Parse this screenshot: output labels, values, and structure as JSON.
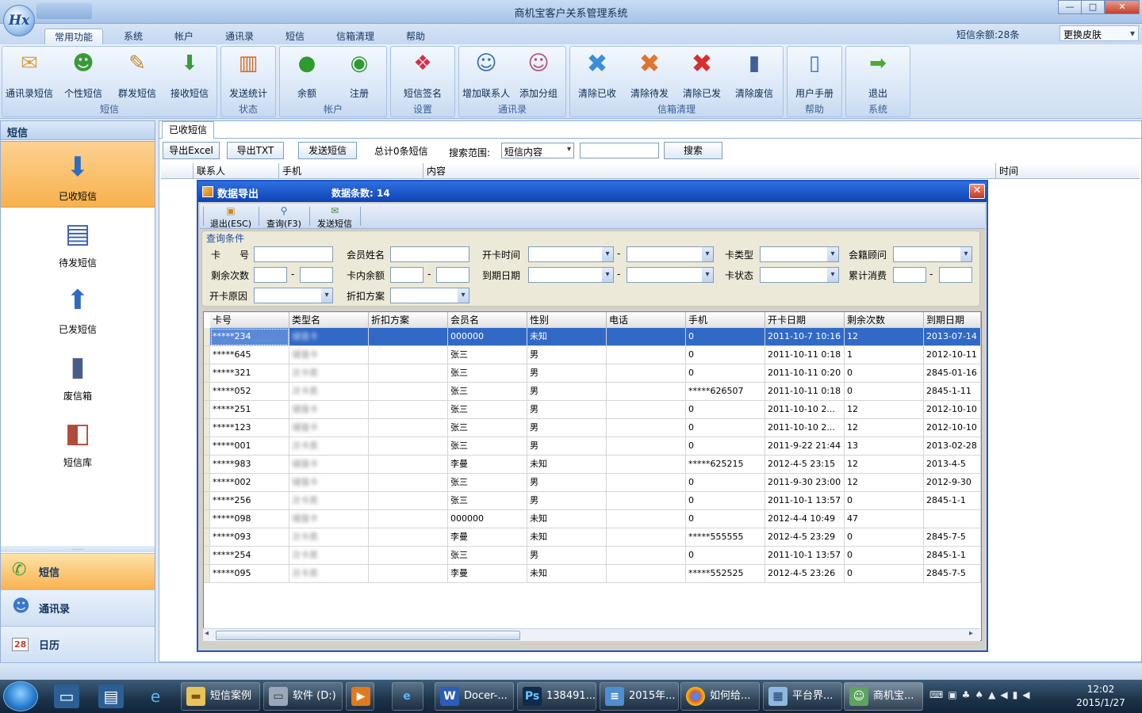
{
  "window": {
    "title": "商机宝客户关系管理系统",
    "logo": "Hx",
    "minimize": "—",
    "maximize": "□",
    "close": "✕"
  },
  "ribbon_tabs": [
    "常用功能",
    "系统",
    "帐户",
    "通讯录",
    "短信",
    "信箱清理",
    "帮助"
  ],
  "sms_balance": "短信余额:28条",
  "skin_label": "更换皮肤",
  "ribbon_groups": [
    {
      "name": "短信",
      "buttons": [
        "通讯录短信",
        "个性短信",
        "群发短信",
        "接收短信"
      ]
    },
    {
      "name": "状态",
      "buttons": [
        "发送统计"
      ]
    },
    {
      "name": "帐户",
      "buttons": [
        "余额",
        "注册"
      ]
    },
    {
      "name": "设置",
      "buttons": [
        "短信签名"
      ]
    },
    {
      "name": "通讯录",
      "buttons": [
        "增加联系人",
        "添加分组"
      ]
    },
    {
      "name": "信箱清理",
      "buttons": [
        "清除已收",
        "清除待发",
        "清除已发",
        "清除废信"
      ]
    },
    {
      "name": "帮助",
      "buttons": [
        "用户手册"
      ]
    },
    {
      "name": "系统",
      "buttons": [
        "退出"
      ]
    }
  ],
  "left_nav": {
    "header": "短信",
    "items": [
      "已收短信",
      "待发短信",
      "已发短信",
      "废信箱",
      "短信库"
    ],
    "grip": "......",
    "bottom": [
      "短信",
      "通讯录",
      "日历"
    ],
    "calendar_day": "28"
  },
  "content": {
    "tab": "已收短信",
    "export_excel": "导出Excel",
    "export_txt": "导出TXT",
    "send_sms": "发送短信",
    "total": "总计0条短信",
    "scope_label": "搜索范围:",
    "scope_value": "短信内容",
    "search_button": "搜索",
    "columns": [
      "联系人",
      "手机",
      "内容",
      "时间"
    ]
  },
  "dialog": {
    "title": "数据导出",
    "count_label": "数据条数: 14",
    "close": "✕",
    "toolbar": [
      "退出(ESC)",
      "查询(F3)",
      "发送短信"
    ],
    "query_legend": "查询条件",
    "fields": {
      "card_no": "卡　　号",
      "member_name": "会员姓名",
      "open_time": "开卡时间",
      "card_type": "卡类型",
      "advisor": "会籍顾问",
      "remain_times": "剩余次数",
      "card_balance": "卡内余额",
      "expire_date": "到期日期",
      "card_status": "卡状态",
      "total_spend": "累计消费",
      "open_reason": "开卡原因",
      "discount_plan": "折扣方案",
      "dash": "-"
    },
    "columns": [
      "卡号",
      "类型名",
      "折扣方案",
      "会员名",
      "性别",
      "电话",
      "手机",
      "开卡日期",
      "剩余次数",
      "到期日期"
    ],
    "rows": [
      [
        "*****234",
        "储值卡",
        "",
        "000000",
        "未知",
        "",
        "0",
        "2011-10-7 10:16",
        "12",
        "2013-07-14"
      ],
      [
        "*****645",
        "储值卡",
        "",
        "张三",
        "男",
        "",
        "0",
        "2011-10-11 0:18",
        "1",
        "2012-10-11"
      ],
      [
        "*****321",
        "次卡类",
        "",
        "张三",
        "男",
        "",
        "0",
        "2011-10-11 0:20",
        "0",
        "2845-01-16"
      ],
      [
        "*****052",
        "次卡类",
        "",
        "张三",
        "男",
        "",
        "*****626507",
        "2011-10-11 0:18",
        "0",
        "2845-1-11"
      ],
      [
        "*****251",
        "储值卡",
        "",
        "张三",
        "男",
        "",
        "0",
        "2011-10-10 2...",
        "12",
        "2012-10-10"
      ],
      [
        "*****123",
        "储值卡",
        "",
        "张三",
        "男",
        "",
        "0",
        "2011-10-10 2...",
        "12",
        "2012-10-10"
      ],
      [
        "*****001",
        "次卡类",
        "",
        "张三",
        "男",
        "",
        "0",
        "2011-9-22 21:44",
        "13",
        "2013-02-28"
      ],
      [
        "*****983",
        "储值卡",
        "",
        "李曼",
        "未知",
        "",
        "*****625215",
        "2012-4-5 23:15",
        "12",
        "2013-4-5"
      ],
      [
        "*****002",
        "储值卡",
        "",
        "张三",
        "男",
        "",
        "0",
        "2011-9-30 23:00",
        "12",
        "2012-9-30"
      ],
      [
        "*****256",
        "次卡类",
        "",
        "张三",
        "男",
        "",
        "0",
        "2011-10-1 13:57",
        "0",
        "2845-1-1"
      ],
      [
        "*****098",
        "储值卡",
        "",
        "000000",
        "未知",
        "",
        "0",
        "2012-4-4 10:49",
        "47",
        ""
      ],
      [
        "*****093",
        "次卡类",
        "",
        "李曼",
        "未知",
        "",
        "*****555555",
        "2012-4-5 23:29",
        "0",
        "2845-7-5"
      ],
      [
        "*****254",
        "次卡类",
        "",
        "张三",
        "男",
        "",
        "0",
        "2011-10-1 13:57",
        "0",
        "2845-1-1"
      ],
      [
        "*****095",
        "次卡类",
        "",
        "李曼",
        "未知",
        "",
        "*****552525",
        "2012-4-5 23:26",
        "0",
        "2845-7-5"
      ]
    ],
    "selected_row": 0
  },
  "taskbar": {
    "tasks": [
      "短信案例",
      "软件 (D:)",
      "",
      "",
      "Docer-...",
      "138491...",
      "2015年...",
      "如何给...",
      "平台界...",
      "商机宝..."
    ],
    "time": "12:02",
    "date": "2015/1/27"
  },
  "icons": {
    "ribbon": [
      "envelope-book-icon",
      "person-sms-icon",
      "group-sms-icon",
      "inbox-download-icon",
      "bar-chart-icon",
      "dollar-coin-icon",
      "register-icon",
      "signature-book-icon",
      "add-contact-icon",
      "add-group-icon",
      "clear-received-icon",
      "clear-pending-icon",
      "clear-sent-icon",
      "trash-can-icon",
      "user-manual-icon",
      "exit-arrow-icon"
    ]
  }
}
